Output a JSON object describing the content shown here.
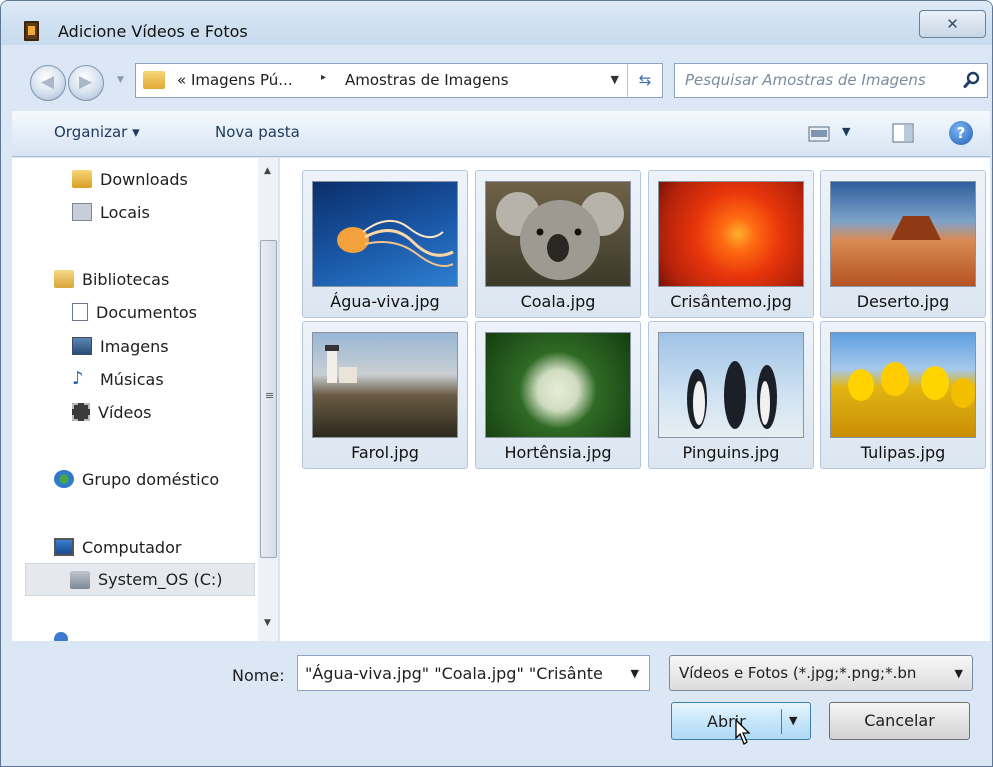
{
  "window": {
    "title": "Adicione Vídeos e Fotos",
    "close_label": "✕"
  },
  "address": {
    "crumbs": [
      "« Imagens Pú...",
      "Amostras de Imagens"
    ],
    "separator": "▸"
  },
  "search": {
    "placeholder": "Pesquisar Amostras de Imagens"
  },
  "toolbar": {
    "organize_label": "Organizar ▾",
    "new_folder_label": "Nova pasta"
  },
  "sidebar": {
    "items": [
      {
        "label": "Downloads",
        "icon": "downloads-folder-icon"
      },
      {
        "label": "Locais",
        "icon": "places-icon"
      },
      {
        "label": "Bibliotecas",
        "icon": "libraries-icon"
      },
      {
        "label": "Documentos",
        "icon": "document-icon"
      },
      {
        "label": "Imagens",
        "icon": "pictures-icon"
      },
      {
        "label": "Músicas",
        "icon": "music-note-icon"
      },
      {
        "label": "Vídeos",
        "icon": "film-icon"
      },
      {
        "label": "Grupo doméstico",
        "icon": "homegroup-icon"
      },
      {
        "label": "Computador",
        "icon": "computer-icon"
      },
      {
        "label": "System_OS (C:)",
        "icon": "drive-icon",
        "selected": true
      }
    ]
  },
  "files": [
    {
      "name": "Água-viva.jpg",
      "subject": "jellyfish"
    },
    {
      "name": "Coala.jpg",
      "subject": "koala"
    },
    {
      "name": "Crisântemo.jpg",
      "subject": "chrysanthemum"
    },
    {
      "name": "Deserto.jpg",
      "subject": "desert"
    },
    {
      "name": "Farol.jpg",
      "subject": "lighthouse"
    },
    {
      "name": "Hortênsia.jpg",
      "subject": "hydrangea"
    },
    {
      "name": "Pinguins.jpg",
      "subject": "penguins"
    },
    {
      "name": "Tulipas.jpg",
      "subject": "tulips"
    }
  ],
  "footer": {
    "name_label": "Nome:",
    "name_value": "\"Água-viva.jpg\" \"Coala.jpg\" \"Crisânte",
    "filter_value": "Vídeos e Fotos (*.jpg;*.png;*.bn",
    "open_label": "Abrir",
    "cancel_label": "Cancelar"
  },
  "colors": {
    "accent": "#3c7fb1",
    "toolbar_text": "#1e395b",
    "window_bg": "#dbe7f4"
  }
}
